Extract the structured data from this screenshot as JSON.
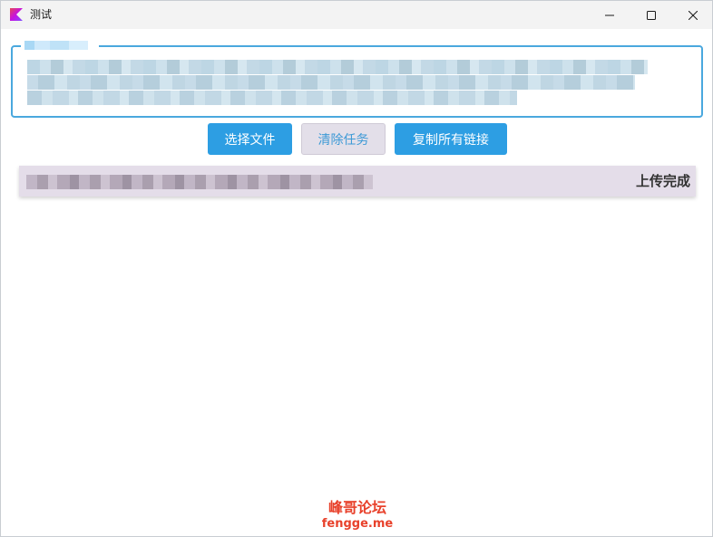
{
  "window": {
    "title": "测试",
    "icon": "kotlin-app-icon",
    "controls": [
      "minimize-icon",
      "maximize-icon",
      "close-icon"
    ]
  },
  "input": {
    "legend": "",
    "value": ""
  },
  "toolbar": {
    "select_file_label": "选择文件",
    "clear_tasks_label": "清除任务",
    "copy_links_label": "复制所有链接"
  },
  "tasks": [
    {
      "name": "",
      "status": "上传完成"
    }
  ],
  "watermark": {
    "title": "峰哥论坛",
    "subtitle": "fengge.me"
  },
  "colors": {
    "accent": "#2d9ee3",
    "border_focus": "#4aa8de",
    "task_bg": "#e4dde9",
    "watermark": "#e8412b"
  }
}
